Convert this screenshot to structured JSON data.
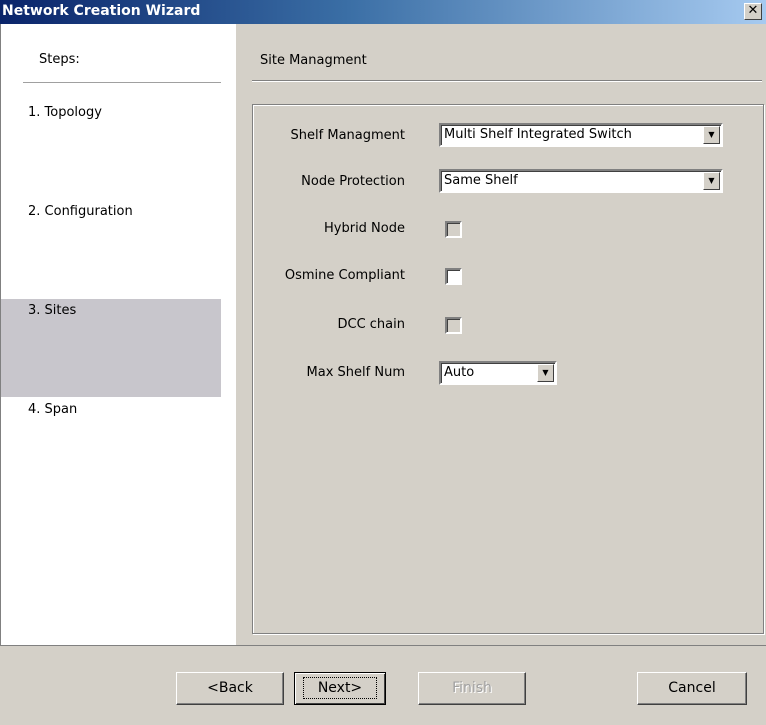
{
  "window": {
    "title": "Network Creation Wizard",
    "close_symbol": "✕"
  },
  "steps": {
    "header": "Steps:",
    "items": [
      {
        "label": "1. Topology",
        "active": false
      },
      {
        "label": "2. Configuration",
        "active": false
      },
      {
        "label": "3. Sites",
        "active": true
      },
      {
        "label": "4. Span",
        "active": false
      }
    ]
  },
  "content": {
    "title": "Site Managment",
    "fields": {
      "shelf_management": {
        "label": "Shelf Managment",
        "value": "Multi Shelf Integrated Switch"
      },
      "node_protection": {
        "label": "Node Protection",
        "value": "Same Shelf"
      },
      "hybrid_node": {
        "label": "Hybrid Node",
        "checked": false,
        "enabled": false
      },
      "osmine_compliant": {
        "label": "Osmine Compliant",
        "checked": false,
        "enabled": true
      },
      "dcc_chain": {
        "label": "DCC chain",
        "checked": false,
        "enabled": false
      },
      "max_shelf_num": {
        "label": "Max Shelf Num",
        "value": "Auto"
      }
    }
  },
  "buttons": {
    "back": "<Back",
    "next": "Next>",
    "finish": "Finish",
    "cancel": "Cancel"
  },
  "icons": {
    "dropdown": "chevron-down-icon",
    "close": "close-icon"
  }
}
